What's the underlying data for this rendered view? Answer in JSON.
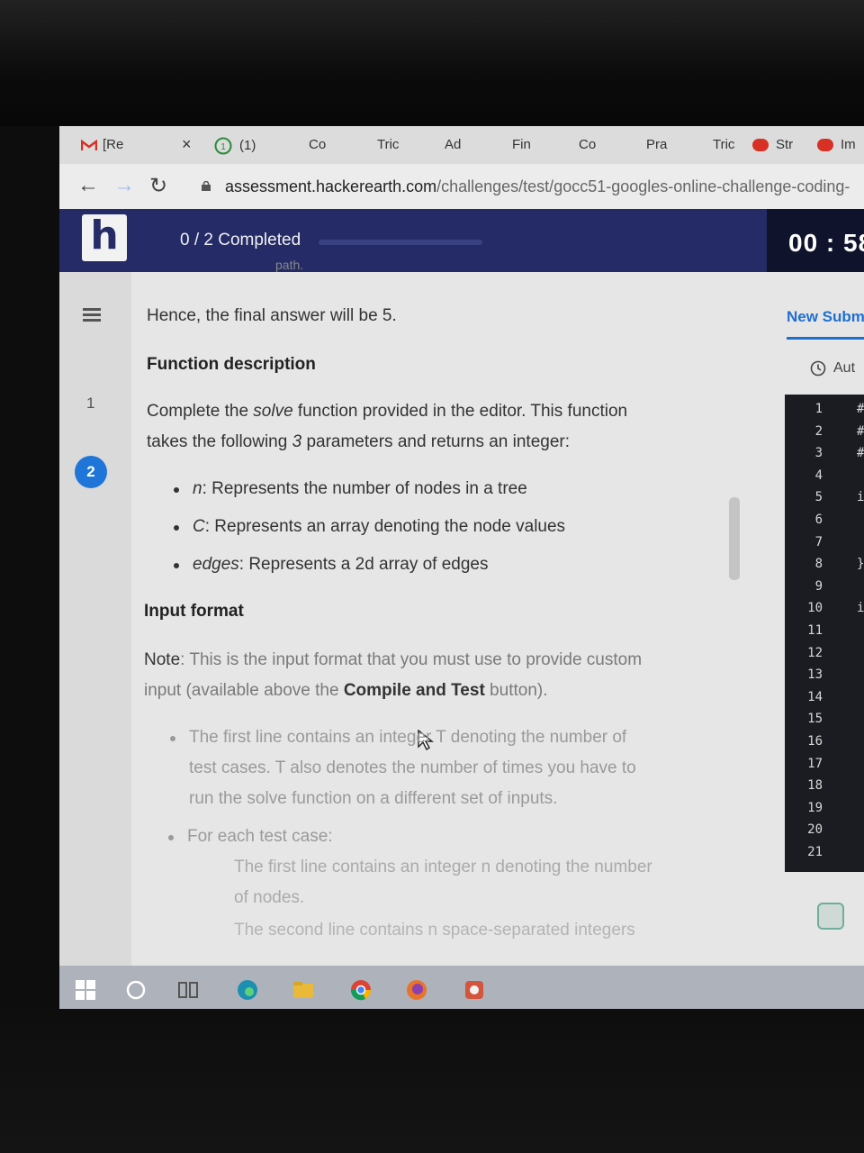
{
  "browser": {
    "tabs": [
      {
        "label": "[Re",
        "icon": "gmail-icon"
      },
      {
        "label": "(1)",
        "icon": "whatsapp-icon"
      },
      {
        "label": "Co"
      },
      {
        "label": "Tric"
      },
      {
        "label": "Ad"
      },
      {
        "label": "Fin"
      },
      {
        "label": "Co"
      },
      {
        "label": "Pra"
      },
      {
        "label": "Tric"
      },
      {
        "label": "Str",
        "icon": "red-badge-icon"
      },
      {
        "label": "Im",
        "icon": "red-badge-icon"
      }
    ],
    "close_label": "×",
    "url_domain": "assessment.hackerearth.com",
    "url_path": "/challenges/test/gocc51-googles-online-challenge-coding-"
  },
  "header": {
    "logo": "h",
    "progress_text": "0 / 2 Completed",
    "progress_fraction": 0.0,
    "timer": "00 : 58"
  },
  "question_nav": {
    "items": [
      "1",
      "2"
    ],
    "active": "2"
  },
  "problem": {
    "partial_top": "path.",
    "final_answer_text": "Hence, the final answer will be 5.",
    "function_heading": "Function description",
    "function_desc_line1_a": "Complete the ",
    "function_desc_line1_em": "solve",
    "function_desc_line1_b": " function provided in the editor. This function",
    "function_desc_line2_a": "takes the following ",
    "function_desc_line2_em": "3",
    "function_desc_line2_b": " parameters and returns an integer:",
    "params": [
      {
        "name": "n",
        "desc": ": Represents the number of nodes in a tree"
      },
      {
        "name": "C",
        "desc": ": Represents an array denoting the node values"
      },
      {
        "name": "edges",
        "desc": ": Represents a 2d array of edges"
      }
    ],
    "input_heading": "Input format",
    "note_label": "Note",
    "note_line1": ": This is the input format that you must use to provide custom",
    "note_line2_a": "input (available above the ",
    "note_line2_b": "Compile and Test",
    "note_line2_c": " button).",
    "format_line1": "The first line contains an integer T denoting the number of",
    "format_line2": "test cases. T also denotes the number of times you have to",
    "format_line3": "run the solve function on a different set of inputs.",
    "format_each": "For each test case:",
    "format_sub1": "The first line contains an integer n denoting the number",
    "format_sub1b": "of nodes.",
    "format_sub2": "The second line contains n space-separated integers"
  },
  "right_panel": {
    "tab_label": "New Subm",
    "auto_label": "Aut",
    "line_numbers": [
      "1",
      "2",
      "3",
      "4",
      "5",
      "6",
      "7",
      "8",
      "9",
      "10",
      "11",
      "12",
      "13",
      "14",
      "15",
      "16",
      "17",
      "18",
      "19",
      "20",
      "21"
    ],
    "code_glyphs": [
      {
        "line": 1,
        "text": "#"
      },
      {
        "line": 2,
        "text": "#"
      },
      {
        "line": 3,
        "text": "#"
      },
      {
        "line": 5,
        "text": "i"
      },
      {
        "line": 8,
        "text": "}"
      },
      {
        "line": 10,
        "text": "i"
      }
    ]
  },
  "taskbar": {
    "items": [
      "windows-icon",
      "search-icon",
      "task-view-icon",
      "edge-icon",
      "file-explorer-icon",
      "chrome-icon",
      "firefox-icon",
      "app-icon"
    ]
  }
}
